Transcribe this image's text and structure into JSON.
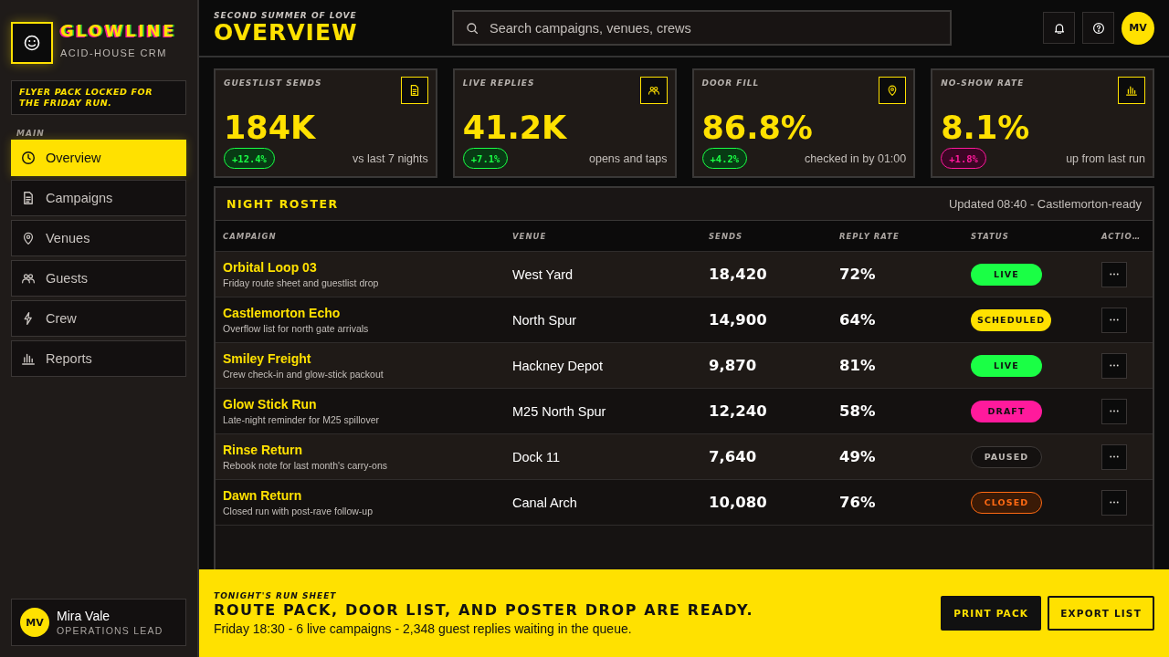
{
  "sidebar": {
    "brand": {
      "name": "GLOWLINE",
      "tagline": "ACID-HOUSE CRM"
    },
    "note": "FLYER PACK LOCKED FOR THE FRIDAY RUN.",
    "section_label": "MAIN",
    "items": [
      {
        "label": "Overview",
        "selected": true
      },
      {
        "label": "Campaigns",
        "selected": false
      },
      {
        "label": "Venues",
        "selected": false
      },
      {
        "label": "Guests",
        "selected": false
      },
      {
        "label": "Crew",
        "selected": false
      },
      {
        "label": "Reports",
        "selected": false
      }
    ],
    "user": {
      "initials": "MV",
      "name": "Mira Vale",
      "role": "OPERATIONS LEAD"
    }
  },
  "header": {
    "kicker": "SECOND SUMMER OF LOVE",
    "title": "OVERVIEW",
    "search": {
      "placeholder": "Search campaigns, venues, crews"
    },
    "avatar": "MV"
  },
  "kpis": [
    {
      "label": "GUESTLIST SENDS",
      "value": "184K",
      "delta": {
        "text": "+12.4%",
        "kind": "good"
      },
      "note": "vs last 7 nights"
    },
    {
      "label": "LIVE REPLIES",
      "value": "41.2K",
      "delta": {
        "text": "+7.1%",
        "kind": "good"
      },
      "note": "opens and taps"
    },
    {
      "label": "DOOR FILL",
      "value": "86.8%",
      "delta": {
        "text": "+4.2%",
        "kind": "good"
      },
      "note": "checked in by 01:00"
    },
    {
      "label": "NO-SHOW RATE",
      "value": "8.1%",
      "delta": {
        "text": "+1.8%",
        "kind": "bad"
      },
      "note": "up from last run"
    }
  ],
  "roster": {
    "title": "NIGHT ROSTER",
    "updated": "Updated 08:40 - Castlemorton-ready",
    "columns": [
      "CAMPAIGN",
      "VENUE",
      "SENDS",
      "REPLY RATE",
      "STATUS",
      "ACTIO…"
    ],
    "rows": [
      {
        "campaign": "Orbital Loop 03",
        "detail": "Friday route sheet and guestlist drop",
        "venue": "West Yard",
        "sends": "18,420",
        "reply_rate": "72%",
        "status": {
          "text": "LIVE",
          "kind": "live"
        }
      },
      {
        "campaign": "Castlemorton Echo",
        "detail": "Overflow list for north gate arrivals",
        "venue": "North Spur",
        "sends": "14,900",
        "reply_rate": "64%",
        "status": {
          "text": "SCHEDULED",
          "kind": "scheduled"
        }
      },
      {
        "campaign": "Smiley Freight",
        "detail": "Crew check-in and glow-stick packout",
        "venue": "Hackney Depot",
        "sends": "9,870",
        "reply_rate": "81%",
        "status": {
          "text": "LIVE",
          "kind": "live"
        }
      },
      {
        "campaign": "Glow Stick Run",
        "detail": "Late-night reminder for M25 spillover",
        "venue": "M25 North Spur",
        "sends": "12,240",
        "reply_rate": "58%",
        "status": {
          "text": "DRAFT",
          "kind": "draft"
        }
      },
      {
        "campaign": "Rinse Return",
        "detail": "Rebook note for last month's carry-ons",
        "venue": "Dock 11",
        "sends": "7,640",
        "reply_rate": "49%",
        "status": {
          "text": "PAUSED",
          "kind": "paused"
        }
      },
      {
        "campaign": "Dawn Return",
        "detail": "Closed run with post-rave follow-up",
        "venue": "Canal Arch",
        "sends": "10,080",
        "reply_rate": "76%",
        "status": {
          "text": "CLOSED",
          "kind": "closed"
        }
      }
    ]
  },
  "run_sheet": {
    "kicker": "TONIGHT'S RUN SHEET",
    "headline": "ROUTE PACK, DOOR LIST, AND POSTER DROP ARE READY.",
    "summary": "Friday 18:30 - 6 live campaigns - 2,348 guest replies waiting in the queue.",
    "buttons": [
      {
        "label": "PRINT PACK",
        "kind": "primary"
      },
      {
        "label": "EXPORT LIST",
        "kind": "secondary"
      }
    ]
  }
}
